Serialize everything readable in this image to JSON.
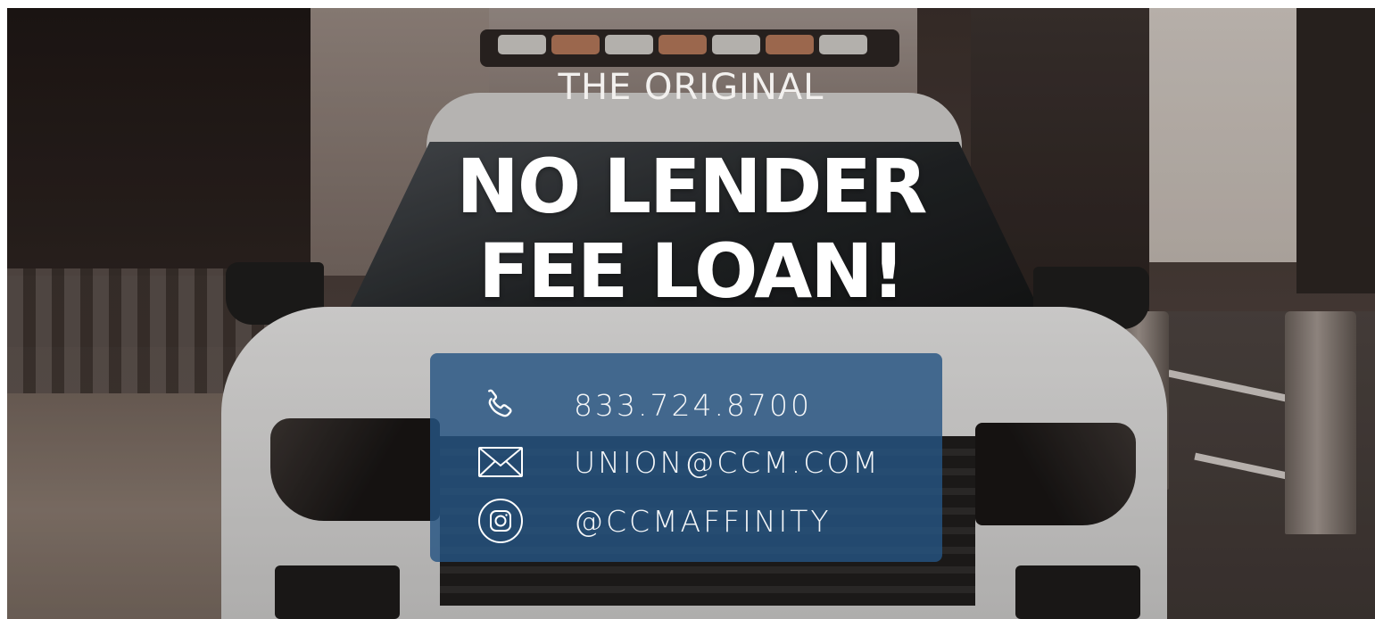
{
  "headline": {
    "eyebrow": "THE ORIGINAL",
    "line1": "NO LENDER",
    "line2": "FEE LOAN!"
  },
  "contact": {
    "phone": {
      "icon": "phone-icon",
      "text": "833.724.8700"
    },
    "email": {
      "icon": "envelope-icon",
      "text": "UNION@CCM.COM"
    },
    "instagram": {
      "icon": "instagram-icon",
      "text": "@CCMAFFINITY"
    }
  },
  "colors": {
    "panel": "#265482",
    "text": "#ffffff"
  }
}
